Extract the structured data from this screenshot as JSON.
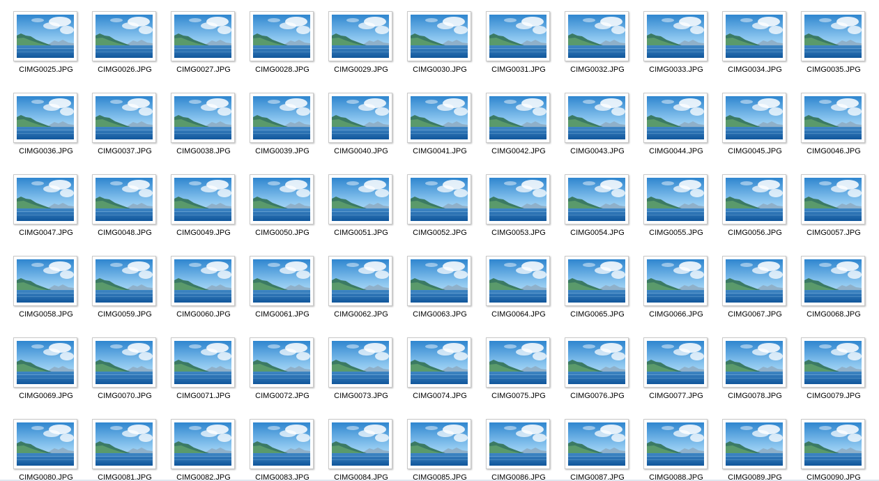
{
  "window": {
    "view": "Large icons",
    "files": [
      "CIMG0025.JPG",
      "CIMG0026.JPG",
      "CIMG0027.JPG",
      "CIMG0028.JPG",
      "CIMG0029.JPG",
      "CIMG0030.JPG",
      "CIMG0031.JPG",
      "CIMG0032.JPG",
      "CIMG0033.JPG",
      "CIMG0034.JPG",
      "CIMG0035.JPG",
      "CIMG0036.JPG",
      "CIMG0037.JPG",
      "CIMG0038.JPG",
      "CIMG0039.JPG",
      "CIMG0040.JPG",
      "CIMG0041.JPG",
      "CIMG0042.JPG",
      "CIMG0043.JPG",
      "CIMG0044.JPG",
      "CIMG0045.JPG",
      "CIMG0046.JPG",
      "CIMG0047.JPG",
      "CIMG0048.JPG",
      "CIMG0049.JPG",
      "CIMG0050.JPG",
      "CIMG0051.JPG",
      "CIMG0052.JPG",
      "CIMG0053.JPG",
      "CIMG0054.JPG",
      "CIMG0055.JPG",
      "CIMG0056.JPG",
      "CIMG0057.JPG",
      "CIMG0058.JPG",
      "CIMG0059.JPG",
      "CIMG0060.JPG",
      "CIMG0061.JPG",
      "CIMG0062.JPG",
      "CIMG0063.JPG",
      "CIMG0064.JPG",
      "CIMG0065.JPG",
      "CIMG0066.JPG",
      "CIMG0067.JPG",
      "CIMG0068.JPG",
      "CIMG0069.JPG",
      "CIMG0070.JPG",
      "CIMG0071.JPG",
      "CIMG0072.JPG",
      "CIMG0073.JPG",
      "CIMG0074.JPG",
      "CIMG0075.JPG",
      "CIMG0076.JPG",
      "CIMG0077.JPG",
      "CIMG0078.JPG",
      "CIMG0079.JPG",
      "CIMG0080.JPG",
      "CIMG0081.JPG",
      "CIMG0082.JPG",
      "CIMG0083.JPG",
      "CIMG0084.JPG",
      "CIMG0085.JPG",
      "CIMG0086.JPG",
      "CIMG0087.JPG",
      "CIMG0088.JPG",
      "CIMG0089.JPG",
      "CIMG0090.JPG"
    ],
    "thumbnail_icon": "jpeg-image-icon"
  }
}
